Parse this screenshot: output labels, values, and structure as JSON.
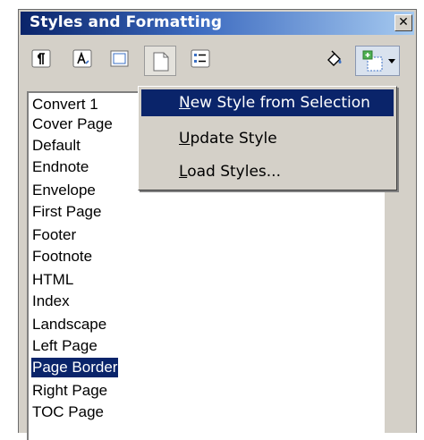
{
  "title": "Styles and Formatting",
  "close_glyph": "✕",
  "toolbar": {
    "buttons": [
      {
        "name": "paragraph-styles-icon"
      },
      {
        "name": "character-styles-icon"
      },
      {
        "name": "frame-styles-icon"
      },
      {
        "name": "page-styles-icon"
      },
      {
        "name": "list-styles-icon"
      },
      {
        "name": "fill-format-mode-icon"
      },
      {
        "name": "new-style-from-selection-icon"
      }
    ]
  },
  "styles_list": {
    "items": [
      "Convert 1",
      "Cover Page",
      "Default",
      "Endnote",
      "Envelope",
      "First Page",
      "Footer",
      "Footnote",
      "HTML",
      "Index",
      "Landscape",
      "Left Page",
      "Page Border",
      "Right Page",
      "TOC Page"
    ],
    "selected": "Page Border"
  },
  "menu": {
    "items": [
      {
        "accel": "N",
        "rest": "ew Style from Selection",
        "highlighted": true
      },
      {
        "accel": "U",
        "rest": "pdate Style",
        "highlighted": false
      },
      {
        "accel": "L",
        "rest": "oad Styles...",
        "highlighted": false
      }
    ]
  },
  "colors": {
    "selection": "#0a246a",
    "panel": "#d4d0c8",
    "title_gradient_start": "#0a246a",
    "title_gradient_end": "#a6caf0"
  }
}
